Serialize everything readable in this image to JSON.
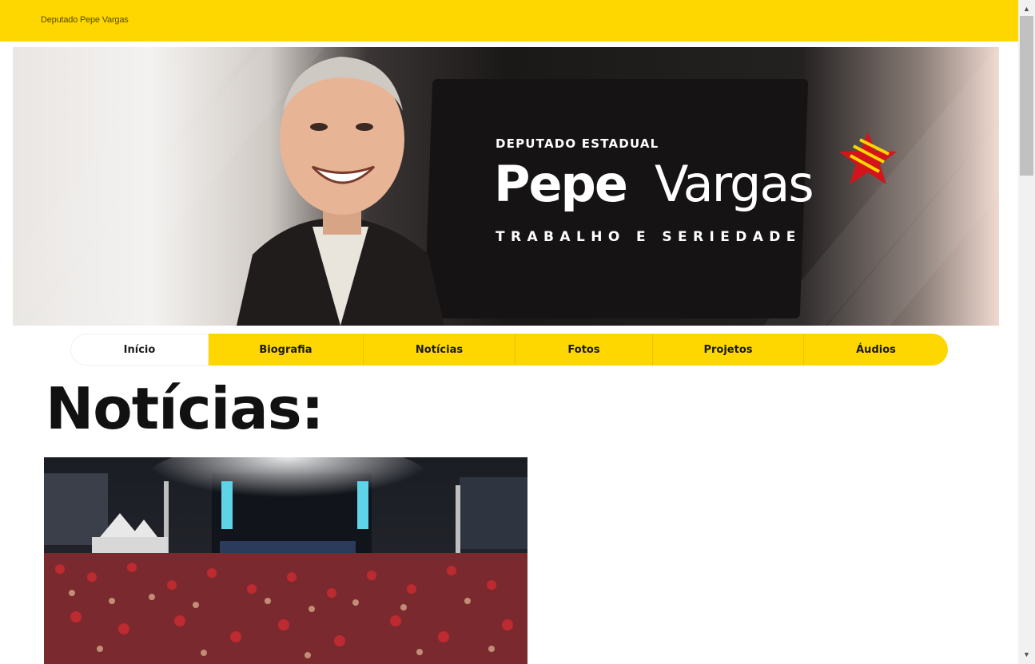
{
  "header": {
    "site_name": "Deputado Pepe Vargas"
  },
  "banner": {
    "subtitle": "DEPUTADO ESTADUAL",
    "name_part1": "Pepe",
    "name_part2": "Vargas",
    "slogan": "TRABALHO E SERIEDADE"
  },
  "nav": {
    "items": [
      {
        "label": "Início",
        "active": true
      },
      {
        "label": "Biografia"
      },
      {
        "label": "Notícias"
      },
      {
        "label": "Fotos"
      },
      {
        "label": "Projetos"
      },
      {
        "label": "Áudios"
      }
    ]
  },
  "main": {
    "heading": "Notícias:"
  },
  "colors": {
    "accent": "#ffd700",
    "star_red": "#d4141b"
  },
  "scrollbar": {
    "up_icon": "arrow-up-icon",
    "down_icon": "arrow-down-icon"
  }
}
